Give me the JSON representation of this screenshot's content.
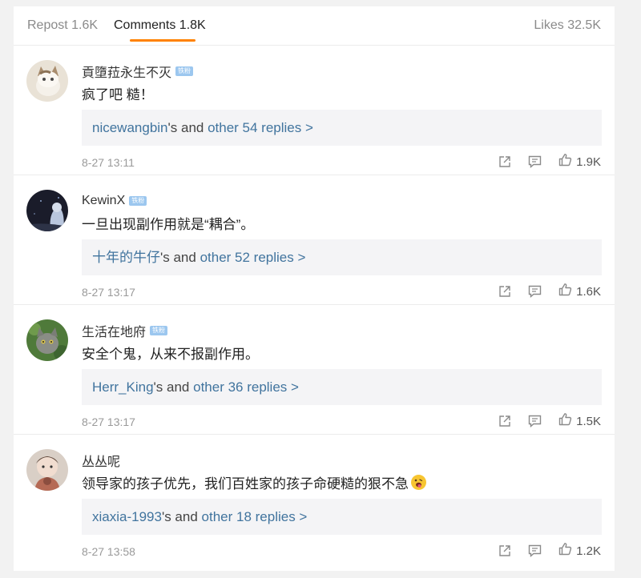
{
  "tabs": {
    "repost": "Repost 1.6K",
    "comments": "Comments 1.8K",
    "likes": "Likes 32.5K"
  },
  "colors": {
    "accent": "#ff8200",
    "link": "#41749e",
    "badge": "#9cc7ef"
  },
  "comments": [
    {
      "username": "貢墮菈永生不灭",
      "badge": "铁粉",
      "text": "疯了吧 糙！",
      "reply_user": "nicewangbin",
      "reply_mid": "'s and ",
      "reply_tail": "other 54 replies >",
      "time": "8-27 13:11",
      "likes": "1.9K"
    },
    {
      "username": "KewinX",
      "badge": "铁粉",
      "text": "一旦出现副作用就是“耦合”。",
      "reply_user": "十年的牛仔",
      "reply_mid": "'s and ",
      "reply_tail": "other 52 replies >",
      "time": "8-27 13:17",
      "likes": "1.6K"
    },
    {
      "username": "生活在地府",
      "badge": "铁粉",
      "text": "安全个鬼，从来不报副作用。",
      "reply_user": "Herr_King",
      "reply_mid": "'s and ",
      "reply_tail": "other 36 replies >",
      "time": "8-27 13:17",
      "likes": "1.5K"
    },
    {
      "username": "丛丛呢",
      "text": "领导家的孩子优先，我们百姓家的孩子命硬糙的狠不急",
      "reply_user": "xiaxia-1993",
      "reply_mid": "'s and ",
      "reply_tail": "other 18 replies >",
      "time": "8-27 13:58",
      "likes": "1.2K"
    }
  ]
}
